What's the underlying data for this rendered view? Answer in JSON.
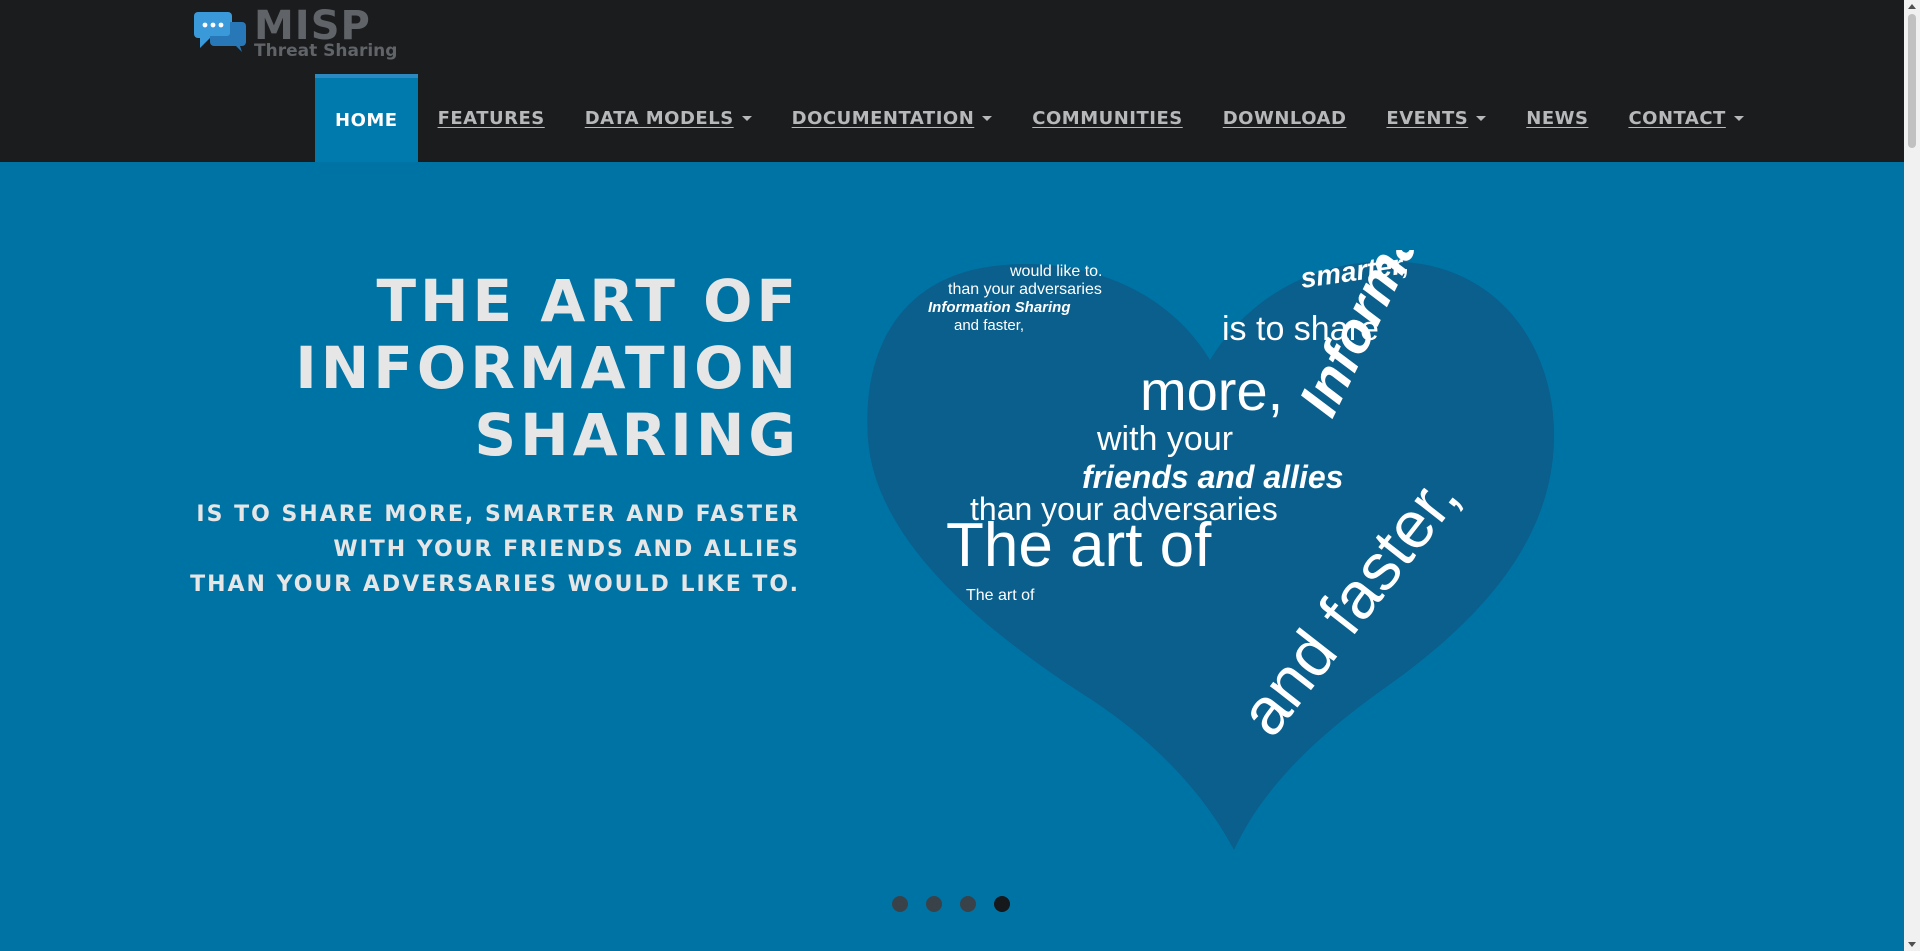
{
  "brand": {
    "name": "MISP",
    "subtitle": "Threat Sharing"
  },
  "nav": {
    "items": [
      {
        "label": "HOME",
        "active": true,
        "dropdown": false
      },
      {
        "label": "FEATURES",
        "active": false,
        "dropdown": false
      },
      {
        "label": "DATA MODELS",
        "active": false,
        "dropdown": true
      },
      {
        "label": "DOCUMENTATION",
        "active": false,
        "dropdown": true
      },
      {
        "label": "COMMUNITIES",
        "active": false,
        "dropdown": false
      },
      {
        "label": "DOWNLOAD",
        "active": false,
        "dropdown": false
      },
      {
        "label": "EVENTS",
        "active": false,
        "dropdown": true
      },
      {
        "label": "NEWS",
        "active": false,
        "dropdown": false
      },
      {
        "label": "CONTACT",
        "active": false,
        "dropdown": true
      }
    ]
  },
  "hero": {
    "title_lines": [
      "THE ART OF",
      "INFORMATION",
      "SHARING"
    ],
    "subtitle_lines": [
      "IS TO SHARE MORE, SMARTER AND FASTER",
      "WITH YOUR FRIENDS AND ALLIES",
      "THAN YOUR ADVERSARIES WOULD LIKE TO."
    ],
    "wordcloud_words": [
      "would like to.",
      "than your adversaries",
      "Information Sharing",
      "and faster,",
      "smarter,",
      "is to share",
      "more,",
      "with your",
      "friends and allies",
      "The art of",
      "than your adversaries",
      "The art of",
      "Information Sharing",
      "and faster,"
    ]
  },
  "carousel": {
    "slides": 4,
    "active_index": 3
  },
  "colors": {
    "navbar_bg": "#1b1c1e",
    "hero_bg": "#0073a5",
    "active_tab": "#0079ad",
    "brand_icon": "#3a9ad9"
  }
}
